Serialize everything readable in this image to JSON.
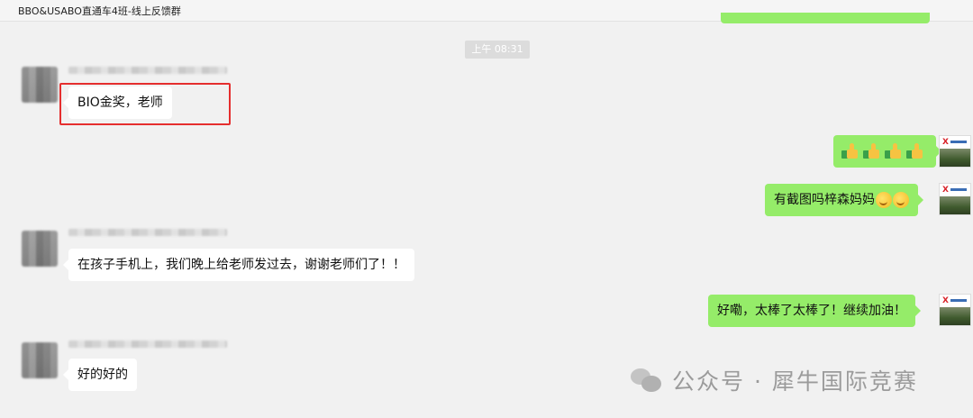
{
  "window": {
    "title": "BBO&USABO直通车4班-线上反馈群"
  },
  "chat": {
    "timestamp": "上午 08:31",
    "messages": [
      {
        "side": "left",
        "text": "BIO金奖，老师"
      },
      {
        "side": "right",
        "text": "👍👍👍👍",
        "emoji": "thumbs-up x4"
      },
      {
        "side": "right",
        "text": "有截图吗梓森妈妈",
        "emoji": "smile-face x2"
      },
      {
        "side": "left",
        "text": "在孩子手机上，我们晚上给老师发过去，谢谢老师们了！！"
      },
      {
        "side": "right",
        "text": "好嘞，太棒了太棒了！继续加油！"
      },
      {
        "side": "left",
        "text": "好的好的"
      }
    ]
  },
  "watermark": {
    "text": "公众号 · 犀牛国际竞赛"
  },
  "colors": {
    "background": "#f1f1f1",
    "bubble_right": "#95ec69",
    "bubble_left": "#ffffff",
    "highlight_border": "#e52e2e"
  }
}
